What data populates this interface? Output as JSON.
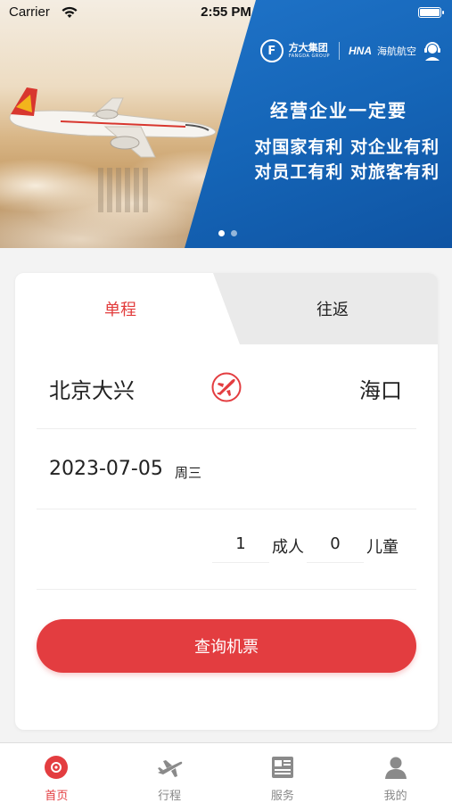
{
  "status_bar": {
    "carrier": "Carrier",
    "time": "2:55 PM"
  },
  "banner": {
    "group_logo_cn": "方大集团",
    "group_logo_en": "FANGDA GROUP",
    "airline_logo": "HNA",
    "airline_name": "海航航空",
    "headline": "经营企业一定要",
    "line1": "对国家有利  对企业有利",
    "line2": "对员工有利  对旅客有利",
    "page_count": 2,
    "active_page": 0
  },
  "booking": {
    "tabs": [
      {
        "label": "单程",
        "active": true
      },
      {
        "label": "往返",
        "active": false
      }
    ],
    "from_city": "北京大兴",
    "to_city": "海口",
    "swap_icon": "plane-swap-icon",
    "date": "2023-07-05",
    "weekday": "周三",
    "adult_count": "1",
    "adult_label": "成人",
    "child_count": "0",
    "child_label": "儿童",
    "search_label": "查询机票"
  },
  "tabbar": {
    "items": [
      {
        "label": "首页",
        "icon": "home-icon",
        "active": true
      },
      {
        "label": "行程",
        "icon": "plane-icon",
        "active": false
      },
      {
        "label": "服务",
        "icon": "news-icon",
        "active": false
      },
      {
        "label": "我的",
        "icon": "user-icon",
        "active": false
      }
    ]
  },
  "colors": {
    "accent": "#e33d40",
    "banner_blue": "#1565b7"
  }
}
